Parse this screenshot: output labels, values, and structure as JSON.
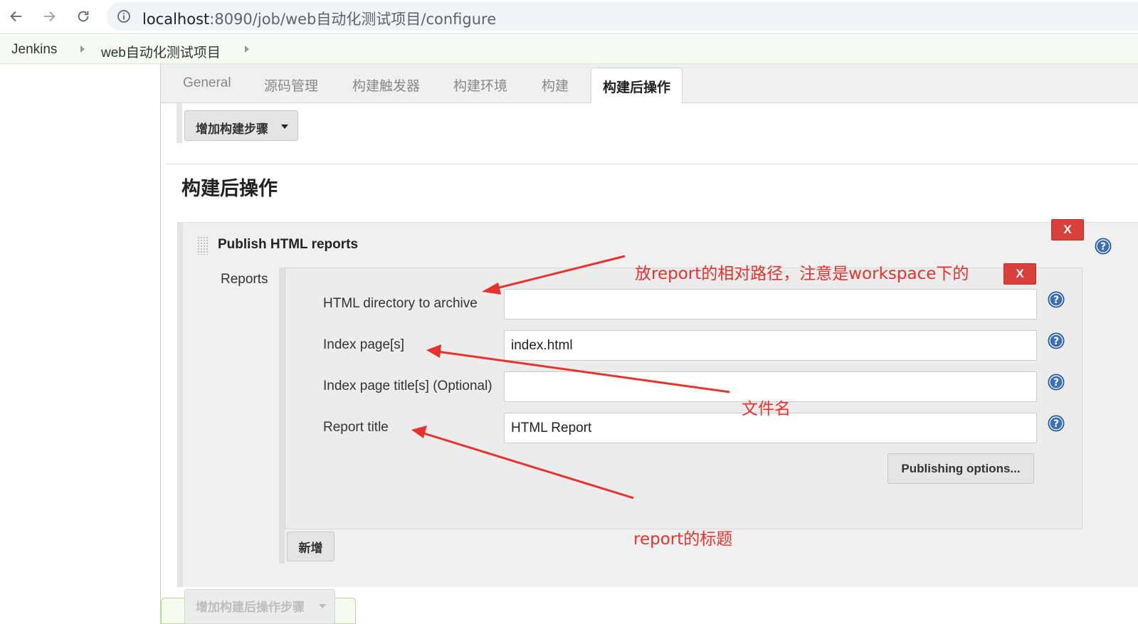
{
  "browser": {
    "url_host": "localhost",
    "url_path": ":8090/job/web自动化测试项目/configure"
  },
  "breadcrumb": {
    "items": [
      "Jenkins",
      "web自动化测试项目"
    ]
  },
  "tabs": [
    {
      "label": "General",
      "active": false
    },
    {
      "label": "源码管理",
      "active": false
    },
    {
      "label": "构建触发器",
      "active": false
    },
    {
      "label": "构建环境",
      "active": false
    },
    {
      "label": "构建",
      "active": false
    },
    {
      "label": "构建后操作",
      "active": true
    }
  ],
  "build": {
    "add_step_label": "增加构建步骤"
  },
  "post_build": {
    "section_title": "构建后操作",
    "publish": {
      "title": "Publish HTML reports",
      "delete_label": "X",
      "reports_label": "Reports",
      "report_delete_label": "X",
      "fields": [
        {
          "label": "HTML directory to archive",
          "value": ""
        },
        {
          "label": "Index page[s]",
          "value": "index.html"
        },
        {
          "label": "Index page title[s] (Optional)",
          "value": ""
        },
        {
          "label": "Report title",
          "value": "HTML Report"
        }
      ],
      "publishing_options_label": "Publishing options...",
      "add_label": "新增"
    },
    "add_post_build_step_label": "增加构建后操作步骤"
  },
  "annotations": {
    "dir_note": "放report的相对路径，注意是workspace下的",
    "filename_note": "文件名",
    "title_note": "report的标题"
  },
  "colors": {
    "annotation": "#e8322e",
    "delete_button": "#d9403a",
    "help_icon": "#3b6fb6"
  }
}
